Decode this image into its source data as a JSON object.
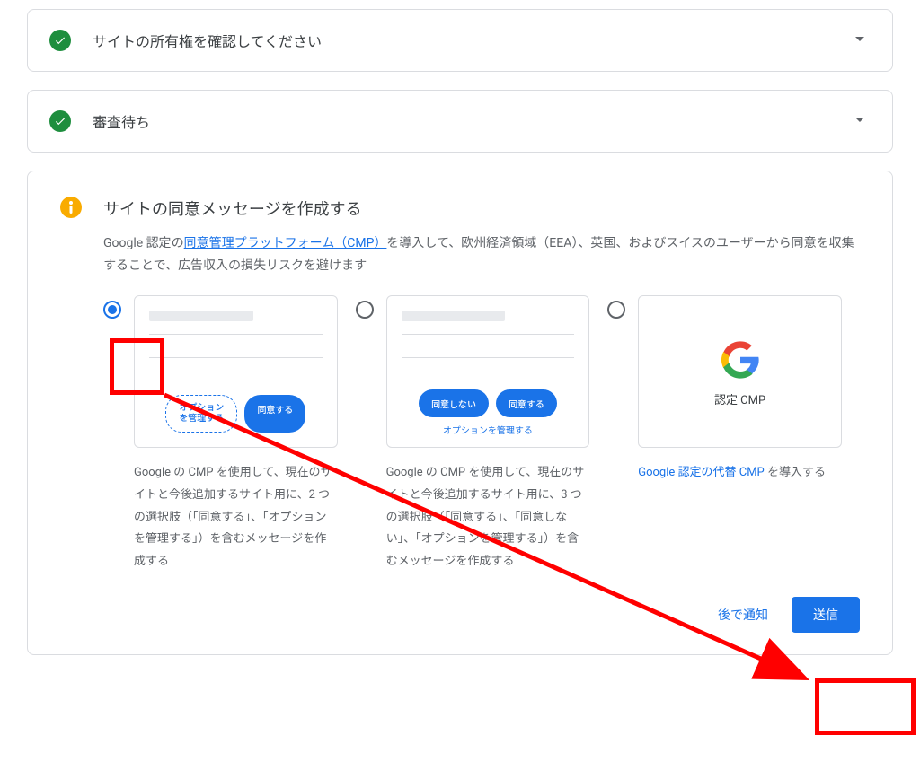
{
  "steps": {
    "verify_site": "サイトの所有権を確認してください",
    "review_wait": "審査待ち"
  },
  "consent": {
    "title": "サイトの同意メッセージを作成する",
    "desc_prefix": "Google 認定の",
    "desc_link": "同意管理プラットフォーム（CMP）",
    "desc_suffix": "を導入して、欧州経済領域（EEA）、英国、およびスイスのユーザーから同意を収集することで、広告収入の損失リスクを避けます"
  },
  "option1": {
    "preview": {
      "manage_btn": "オプションを管理する",
      "agree_btn": "同意する"
    },
    "desc": "Google の CMP を使用して、現在のサイトと今後追加するサイト用に、2 つの選択肢（「同意する」、「オプションを管理する」）を含むメッセージを作成する"
  },
  "option2": {
    "preview": {
      "disagree_btn": "同意しない",
      "agree_btn": "同意する",
      "manage_link": "オプションを管理する"
    },
    "desc": "Google の CMP を使用して、現在のサイトと今後追加するサイト用に、3 つの選択肢（「同意する」、「同意しない」、「オプションを管理する」）を含むメッセージを作成する"
  },
  "option3": {
    "cmp_label": "認定 CMP",
    "desc_link": "Google 認定の代替 CMP",
    "desc_suffix": " を導入する"
  },
  "actions": {
    "later": "後で通知",
    "submit": "送信"
  }
}
